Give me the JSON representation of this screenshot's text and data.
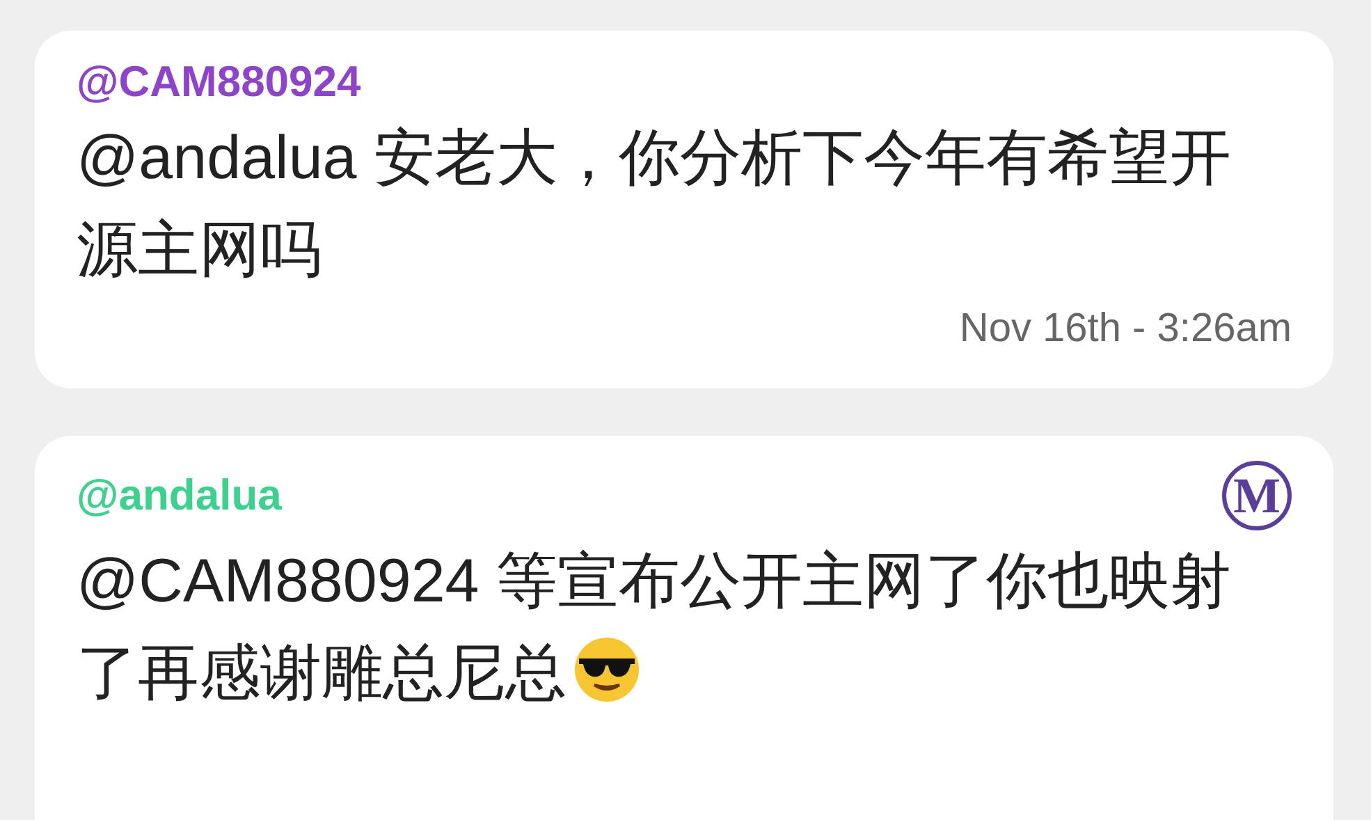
{
  "messages": [
    {
      "author": "@CAM880924",
      "color": "#8e44c8",
      "text": "@andalua 安老大，你分析下今年有希望开源主网吗",
      "time": "Nov 16th - 3:26am"
    },
    {
      "author": "@andalua",
      "color": "#3fcf8e",
      "badge": "M",
      "text": "@CAM880924 等宣布公开主网了你也映射了再感谢雕总尼总",
      "emoji": true
    }
  ]
}
